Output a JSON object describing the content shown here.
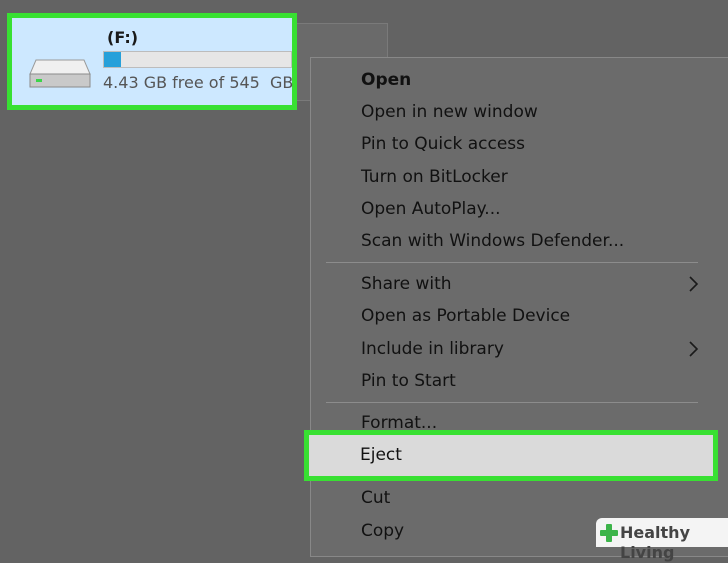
{
  "drive": {
    "name": "(F:)",
    "free_text": "4.43 GB free of 545  GB",
    "used_fraction": 0.09,
    "icon": "hard-drive-icon"
  },
  "menu": {
    "open": "Open",
    "open_new_window": "Open in new window",
    "pin_quick_access": "Pin to Quick access",
    "bitlocker": "Turn on BitLocker",
    "autoplay": "Open AutoPlay...",
    "defender": "Scan with Windows Defender...",
    "share_with": "Share with",
    "portable_device": "Open as Portable Device",
    "include_library": "Include in library",
    "pin_start": "Pin to Start",
    "format": "Format...",
    "eject": "Eject",
    "cut": "Cut",
    "copy": "Copy"
  },
  "watermark": {
    "text": "Healthy Living"
  },
  "colors": {
    "highlight_border": "#38e032",
    "selected_tile": "#cde8ff",
    "progress_fill": "#26a0da",
    "dim_overlay": "#636363"
  }
}
